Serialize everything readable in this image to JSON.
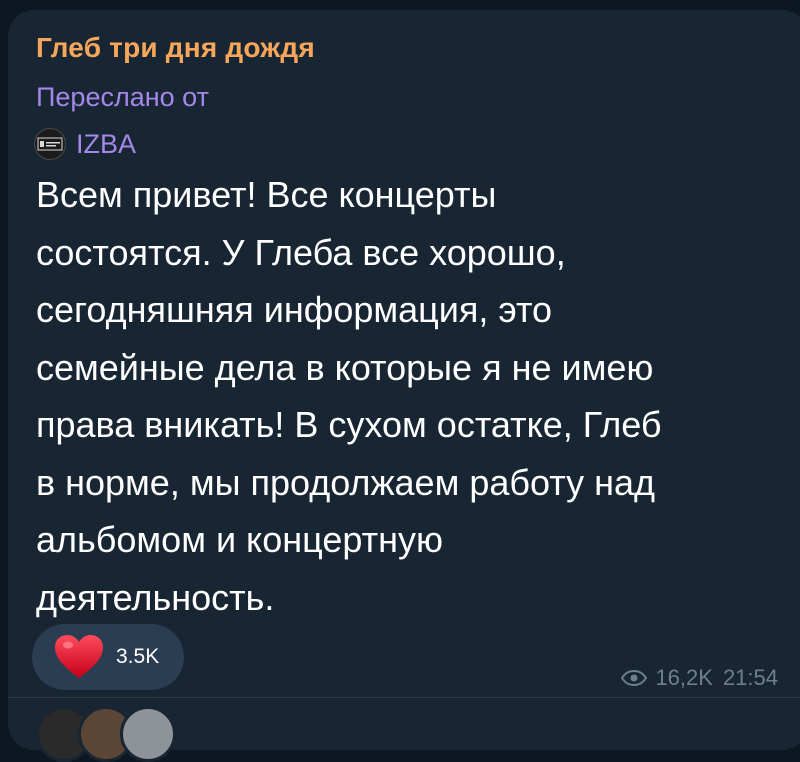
{
  "post": {
    "channel_name": "Глеб три дня дождя",
    "forwarded_label": "Переслано от",
    "forwarded_from": "IZBA",
    "text": "Всем привет! Все концерты\nсостоятся. У Глеба все хорошо,\nсегодняшняя информация, это\nсемейные дела в которые я не имею\nправа вникать! В сухом остатке, Глеб\nв норме, мы продолжаем работу над\nальбомом и концертную\nдеятельность."
  },
  "reaction": {
    "icon": "heart-icon",
    "count": "3.5K"
  },
  "meta": {
    "views": "16,2K",
    "time": "21:54"
  },
  "colors": {
    "background": "#0e1621",
    "bubble": "#182533",
    "channel_name": "#f7a65a",
    "forward": "#a487e8",
    "reaction_bg": "#2b3d52",
    "meta": "#6d7f8f"
  }
}
